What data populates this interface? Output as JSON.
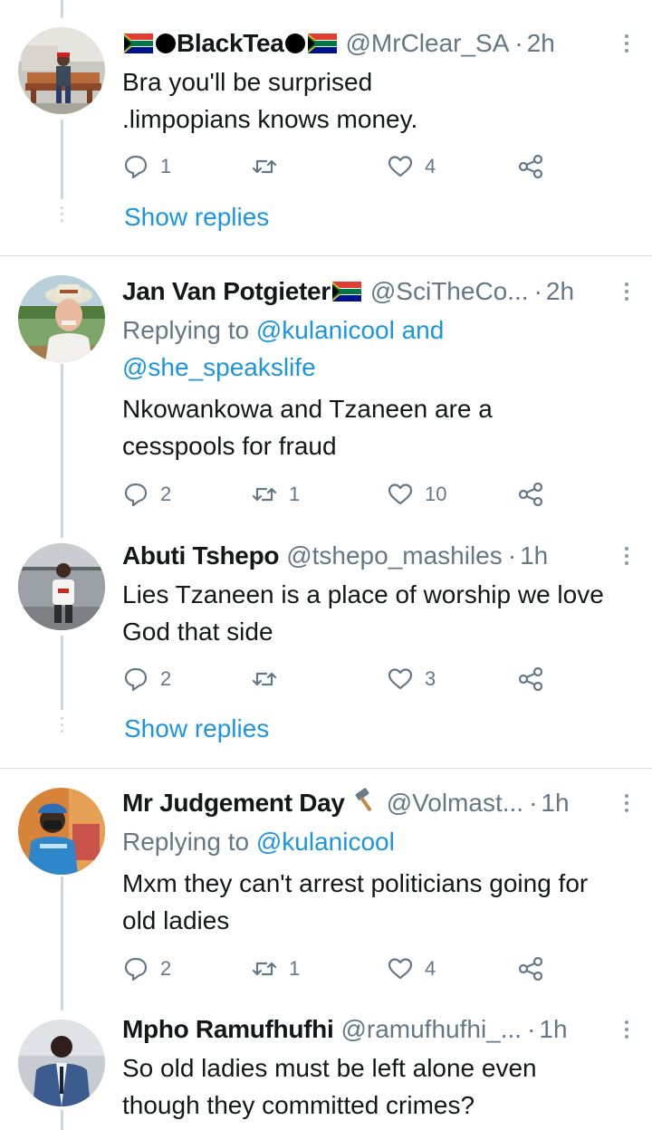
{
  "tweets": [
    {
      "display_name_pre_flag": true,
      "name": "BlackTea",
      "handle": "@MrClear_SA",
      "time": "2h",
      "reply_to": null,
      "lines": [
        "Bra you'll be surprised",
        ".limpopians knows money."
      ],
      "replies": "1",
      "retweets": "",
      "likes": "4",
      "show_replies": "Show replies"
    },
    {
      "name": "Jan Van Potgieter",
      "handle": "@SciTheCo...",
      "time": "2h",
      "reply_to": {
        "label": "Replying to",
        "mention1": "@kulanicool",
        "conj": "and",
        "mention2": "@she_speakslife"
      },
      "lines": [
        "Nkowankowa and Tzaneen are a",
        "cesspools for fraud"
      ],
      "replies": "2",
      "retweets": "1",
      "likes": "10"
    },
    {
      "name": "Abuti Tshepo",
      "handle": "@tshepo_mashiles",
      "time": "1h",
      "reply_to": null,
      "lines": [
        "Lies Tzaneen is a place of worship we love",
        "God that side"
      ],
      "replies": "2",
      "retweets": "",
      "likes": "3",
      "show_replies": "Show replies"
    },
    {
      "name": "Mr Judgement Day",
      "name_emoji": "hammer-icon",
      "handle": "@Volmast...",
      "time": "1h",
      "reply_to": {
        "label": "Replying to",
        "mention1": "@kulanicool"
      },
      "lines": [
        "Mxm they can't arrest politicians going for",
        "old ladies"
      ],
      "replies": "2",
      "retweets": "1",
      "likes": "4"
    },
    {
      "name": "Mpho Ramufhufhi",
      "handle": "@ramufhufhi_...",
      "time": "1h",
      "reply_to": null,
      "lines": [
        "So old ladies must be left alone even",
        "though they committed crimes?"
      ]
    }
  ],
  "separator": "·",
  "colors": {
    "link": "#1b95e0",
    "secondary": "#657786",
    "text": "#14171a",
    "thread": "#ccd6dd"
  }
}
